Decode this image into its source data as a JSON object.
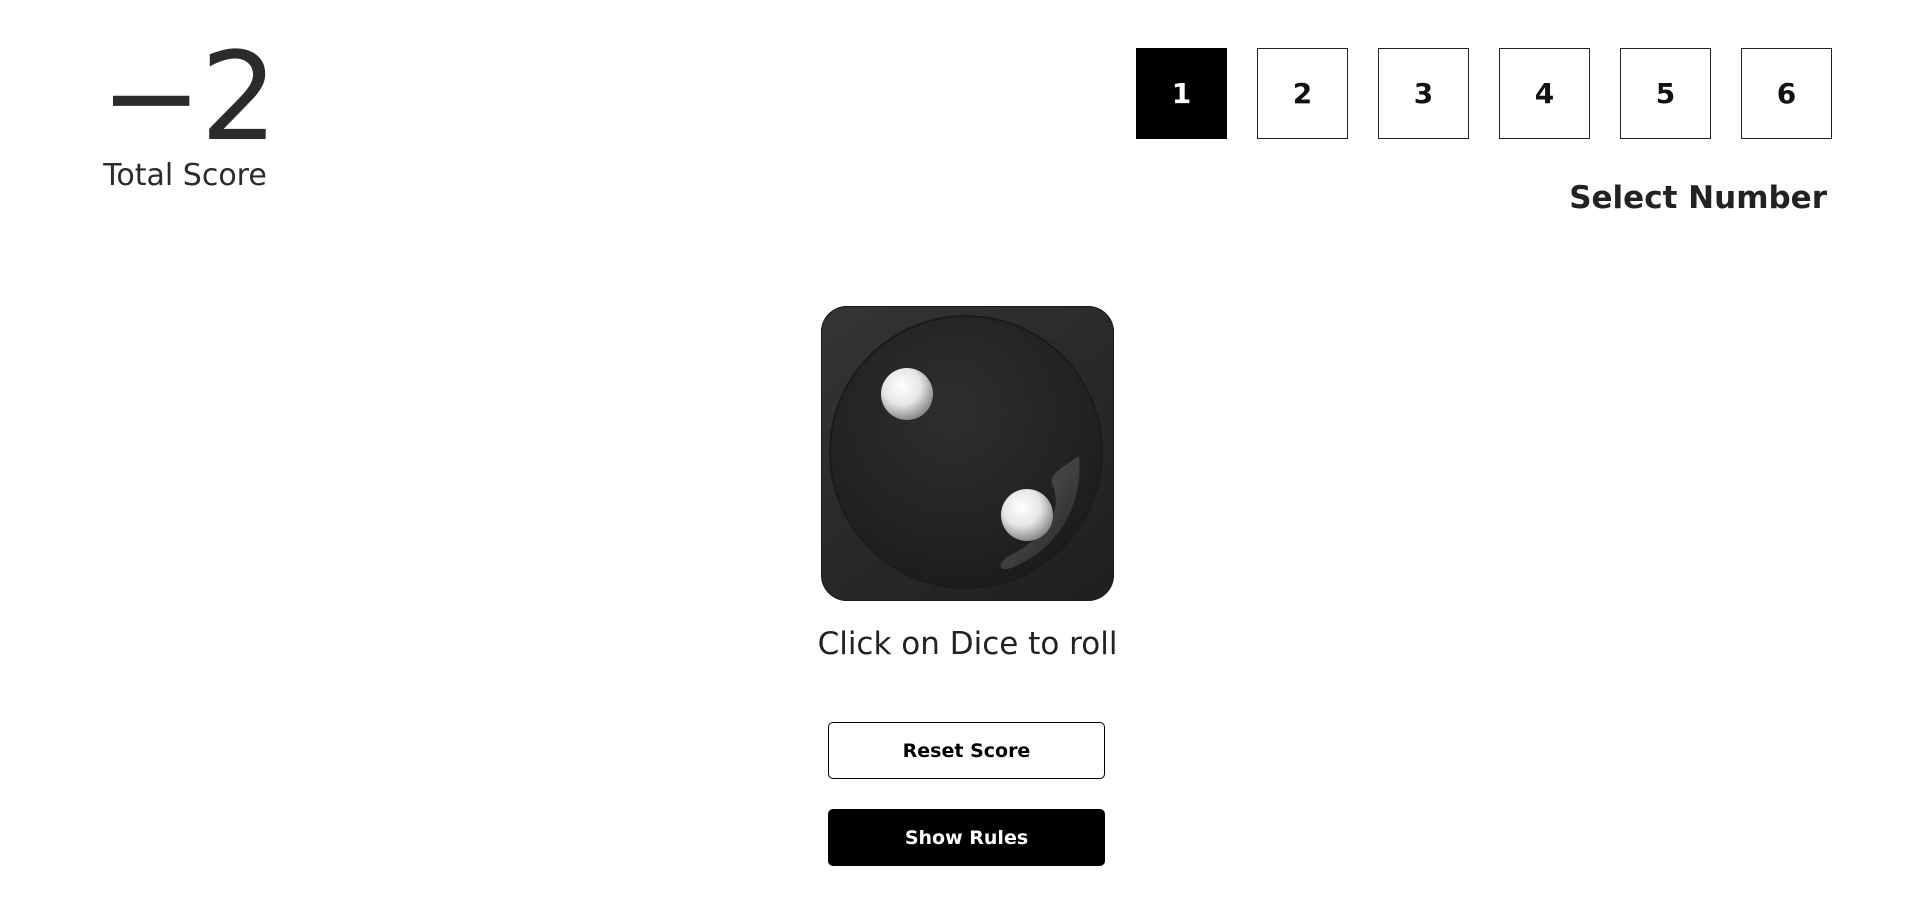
{
  "score": {
    "value": "−2",
    "label": "Total Score"
  },
  "selector": {
    "numbers": [
      "1",
      "2",
      "3",
      "4",
      "5",
      "6"
    ],
    "selected": "1",
    "label": "Select Number"
  },
  "dice": {
    "face_value": 2,
    "hint": "Click on Dice to roll"
  },
  "buttons": {
    "reset_label": "Reset Score",
    "rules_label": "Show Rules"
  },
  "colors": {
    "accent": "#000000",
    "background": "#ffffff",
    "text": "#222222"
  }
}
